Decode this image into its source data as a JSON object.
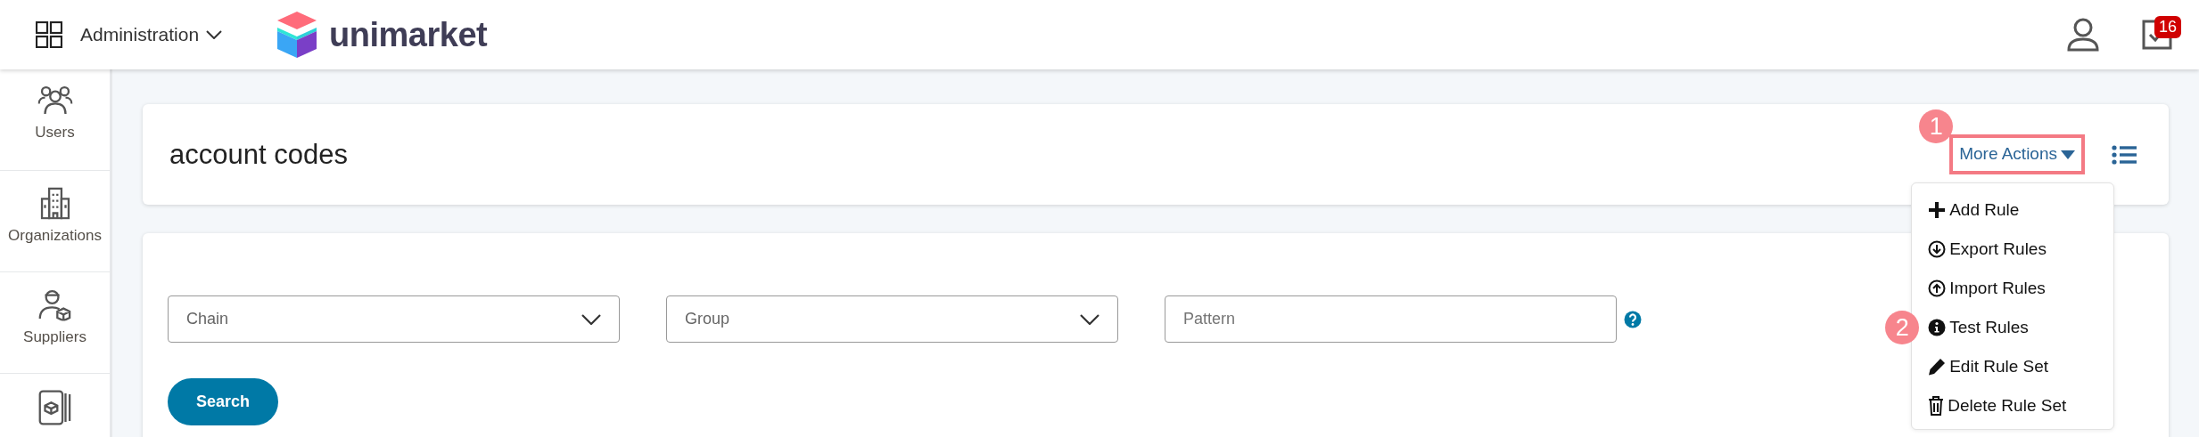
{
  "header": {
    "app_menu": "Administration",
    "brand": "unimarket",
    "task_count": "16"
  },
  "sidebar": {
    "items": [
      {
        "kind": "users",
        "label": "Users"
      },
      {
        "kind": "organizations",
        "label": "Organizations"
      },
      {
        "kind": "suppliers",
        "label": "Suppliers"
      },
      {
        "kind": "catalogs"
      }
    ]
  },
  "page": {
    "title": "account codes",
    "more_actions": {
      "label": "More Actions",
      "highlighted": true,
      "callout": "1"
    },
    "menu": [
      {
        "kind": "plus",
        "label": "Add Rule"
      },
      {
        "kind": "download",
        "label": "Export Rules"
      },
      {
        "kind": "upload",
        "label": "Import Rules"
      },
      {
        "kind": "info",
        "label": "Test Rules",
        "callout": "2"
      },
      {
        "kind": "pencil",
        "label": "Edit Rule Set"
      },
      {
        "kind": "trash",
        "label": "Delete Rule Set"
      }
    ]
  },
  "filters": [
    {
      "kind": "select",
      "placeholder": "Chain"
    },
    {
      "kind": "select",
      "placeholder": "Group"
    },
    {
      "kind": "text",
      "placeholder": "Pattern",
      "help": true
    }
  ],
  "search_button": "Search"
}
